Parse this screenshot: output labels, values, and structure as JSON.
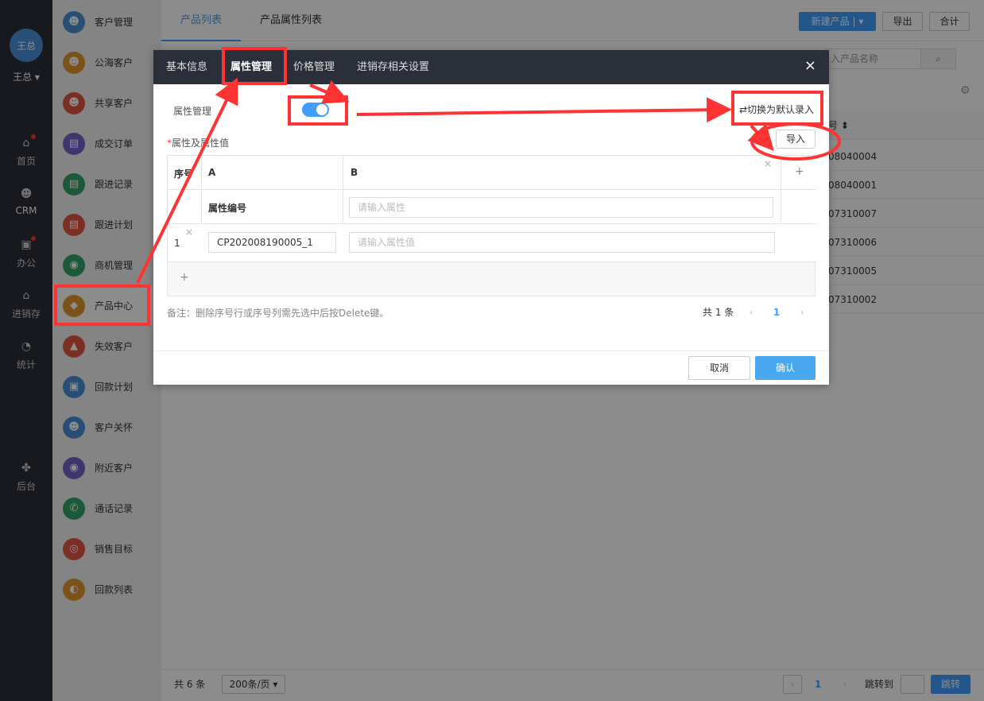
{
  "user": {
    "avatar_text": "王总",
    "name": "王总 ▾"
  },
  "nav": [
    {
      "label": "首页",
      "icon": "home-icon"
    },
    {
      "label": "CRM",
      "icon": "people-icon"
    },
    {
      "label": "办公",
      "icon": "briefcase-icon"
    },
    {
      "label": "进销存",
      "icon": "inventory-icon"
    },
    {
      "label": "统计",
      "icon": "pie-chart-icon"
    },
    {
      "label": "后台",
      "icon": "settings-grid-icon"
    }
  ],
  "submenu": [
    {
      "label": "客户管理",
      "color": "#4a8fd6"
    },
    {
      "label": "公海客户",
      "color": "#e0952c"
    },
    {
      "label": "共享客户",
      "color": "#e0573f"
    },
    {
      "label": "成交订单",
      "color": "#6f64c9"
    },
    {
      "label": "跟进记录",
      "color": "#32a26b"
    },
    {
      "label": "跟进计划",
      "color": "#e0573f"
    },
    {
      "label": "商机管理",
      "color": "#32a26b"
    },
    {
      "label": "产品中心",
      "color": "#e0952c"
    },
    {
      "label": "失效客户",
      "color": "#e0573f"
    },
    {
      "label": "回款计划",
      "color": "#4a8fd6"
    },
    {
      "label": "客户关怀",
      "color": "#4a8fd6"
    },
    {
      "label": "附近客户",
      "color": "#6f64c9"
    },
    {
      "label": "通话记录",
      "color": "#32a26b"
    },
    {
      "label": "销售目标",
      "color": "#e0573f"
    },
    {
      "label": "回款列表",
      "color": "#e0952c"
    }
  ],
  "top_tabs": [
    "产品列表",
    "产品属性列表"
  ],
  "top_buttons": {
    "new_product": "新建产品 | ▾",
    "export": "导出",
    "total": "合计"
  },
  "search": {
    "placeholder": "入产品名称"
  },
  "table": {
    "header": "号 ⬍",
    "rows": [
      "08040004",
      "08040001",
      "07310007",
      "07310006",
      "07310005",
      "07310002"
    ]
  },
  "footer": {
    "count": "共 6 条",
    "page_size": "200条/页 ▾",
    "page": "1",
    "goto_label": "跳转到",
    "goto_button": "跳转"
  },
  "modal": {
    "tabs": [
      "基本信息",
      "属性管理",
      "价格管理",
      "进销存相关设置"
    ],
    "close": "×",
    "attr_mgmt_label": "属性管理",
    "switch_link": "⇄切换为默认录入",
    "required_mark": "*",
    "attr_values_label": "属性及属性值",
    "import_button": "导入",
    "grid": {
      "col_index": "序号",
      "col_a": "A",
      "col_b": "B",
      "add_col": "+",
      "remove_col": "×",
      "attr_code_label": "属性编号",
      "attr_input_placeholder": "请输入属性",
      "row_index": "1",
      "row_remove": "×",
      "row_code_value": "CP202008190005_1",
      "row_value_placeholder": "请输入属性值",
      "add_row": "+"
    },
    "note": "备注：删除序号行或序号列需先选中后按Delete键。",
    "pager": {
      "total": "共 1 条",
      "prev": "‹",
      "page": "1",
      "next": "›"
    },
    "cancel": "取消",
    "confirm": "确认"
  }
}
